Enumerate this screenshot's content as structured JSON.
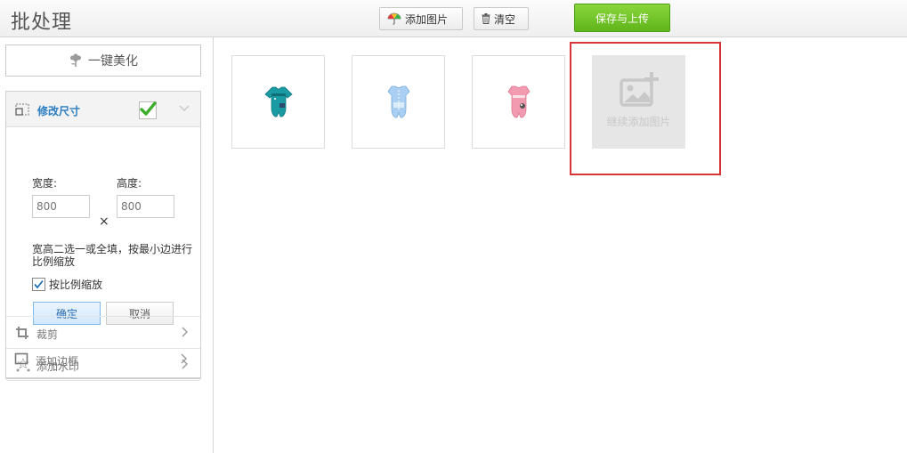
{
  "header": {
    "title": "批处理",
    "add_label": "添加图片",
    "clear_label": "清空",
    "save_label": "保存与上传"
  },
  "sidebar": {
    "beautify_label": "一键美化",
    "resize": {
      "label": "修改尺寸",
      "width_label": "宽度:",
      "height_label": "高度:",
      "width_placeholder": "800",
      "height_placeholder": "800",
      "times_symbol": "×",
      "hint": "宽高二选一或全填，按最小边进行比例缩放",
      "keep_ratio_label": "按比例缩放",
      "keep_ratio_checked": true,
      "ok_label": "确定",
      "cancel_label": "取消"
    },
    "tools": [
      {
        "label": "裁剪",
        "icon": "crop-icon"
      },
      {
        "label": "添加水印",
        "icon": "watermark-icon"
      },
      {
        "label": "添加边框",
        "icon": "border-icon"
      }
    ]
  },
  "main": {
    "images": [
      {
        "name": "teal-romper",
        "color": "#1fa0a8"
      },
      {
        "name": "blue-romper",
        "color": "#8fc3ee"
      },
      {
        "name": "pink-romper",
        "color": "#ef8fa3"
      }
    ],
    "add_more_label": "继续添加图片"
  },
  "colors": {
    "accent_blue": "#2a7dc1",
    "save_green": "#6cc324",
    "highlight_red": "#d9363a"
  }
}
